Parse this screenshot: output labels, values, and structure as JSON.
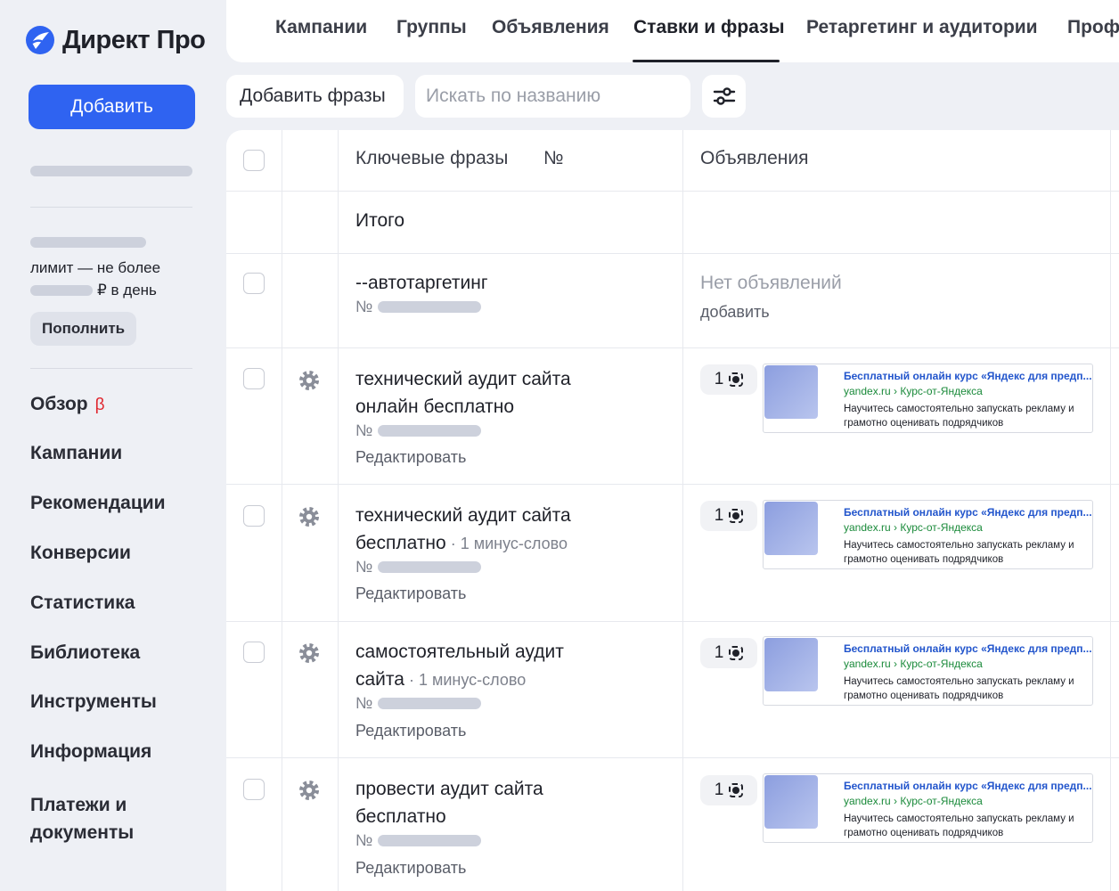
{
  "logo": {
    "text": "Директ Про"
  },
  "sidebar": {
    "add_label": "Добавить",
    "limit_line1": "лимит — не более",
    "limit_line2": "₽ в день",
    "refill_label": "Пополнить",
    "beta": "β",
    "nav": [
      {
        "label": "Обзор"
      },
      {
        "label": "Кампании"
      },
      {
        "label": "Рекомендации"
      },
      {
        "label": "Конверсии"
      },
      {
        "label": "Статистика"
      },
      {
        "label": "Библиотека"
      },
      {
        "label": "Инструменты"
      },
      {
        "label": "Информация"
      },
      {
        "label": "Платежи и документы"
      }
    ]
  },
  "tabs": [
    {
      "label": "Кампании"
    },
    {
      "label": "Группы"
    },
    {
      "label": "Объявления"
    },
    {
      "label": "Ставки и фразы",
      "active": true
    },
    {
      "label": "Ретаргетинг и аудитории"
    },
    {
      "label": "Профили"
    }
  ],
  "toolbar": {
    "add_phrases": "Добавить фразы",
    "search_placeholder": "Искать по названию"
  },
  "table": {
    "headers": {
      "phrases": "Ключевые фразы",
      "num": "№",
      "ads": "Объявления"
    },
    "total_label": "Итого",
    "num_prefix": "№",
    "edit_label": "Редактировать",
    "autotarget": {
      "title": "--автотаргетинг",
      "no_ads": "Нет объявлений",
      "add": "добавить"
    },
    "rows": [
      {
        "line1": "технический аудит сайта",
        "line2": "онлайн бесплатно",
        "minus": ""
      },
      {
        "line1": "технический аудит сайта",
        "line2": "бесплатно",
        "minus": " · 1 минус-слово"
      },
      {
        "line1": "самостоятельный аудит",
        "line2": "сайта",
        "minus": " · 1 минус-слово"
      },
      {
        "line1": "провести аудит сайта",
        "line2": "бесплатно",
        "minus": ""
      }
    ],
    "ad": {
      "count": "1",
      "title": "Бесплатный онлайн курс «Яндекс для предп...",
      "url": "yandex.ru › Курс-от-Яндекса",
      "desc": "Научитесь самостоятельно запускать рекламу и грамотно оценивать подрядчиков"
    }
  },
  "colors": {
    "accent": "#2f63f1",
    "beta": "#e0272f",
    "ad_title": "#2255cc",
    "ad_url": "#1a8a3a"
  }
}
